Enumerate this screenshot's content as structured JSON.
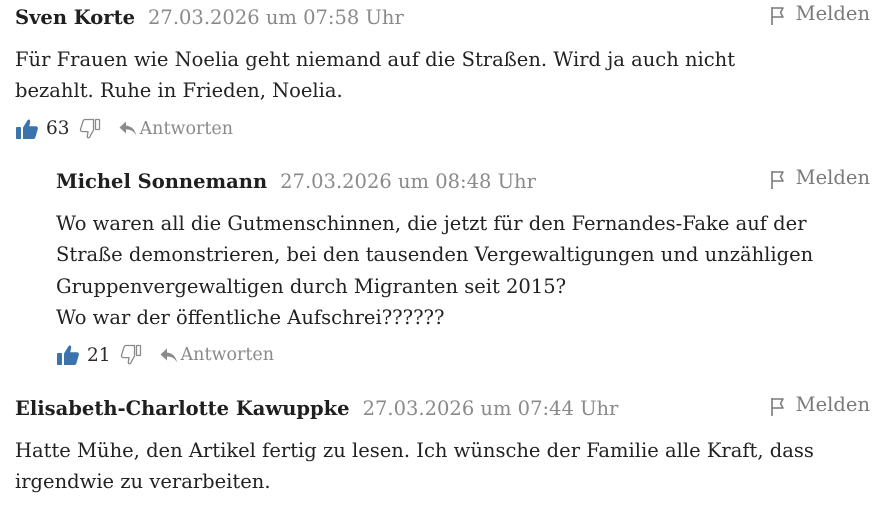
{
  "colors": {
    "accent": "#3b74ad",
    "muted": "#8a8a8a",
    "text": "#222222"
  },
  "icons": {
    "report": "flag-icon",
    "like": "thumbs-up-icon",
    "dislike": "thumbs-down-icon",
    "reply": "reply-arrow-icon"
  },
  "comments": [
    {
      "author": "Sven Korte",
      "date": "27.03.2026 um 07:58 Uhr",
      "report_label": "Melden",
      "lines": [
        "Für Frauen wie Noelia geht niemand auf die Straßen. Wird ja auch nicht",
        "bezahlt. Ruhe in Frieden, Noelia."
      ],
      "likes": "63",
      "reply_label": "Antworten"
    },
    {
      "author": "Michel Sonnemann",
      "date": "27.03.2026 um 08:48 Uhr",
      "report_label": "Melden",
      "lines": [
        "Wo waren all die Gutmenschinnen, die jetzt für den Fernandes-Fake auf der",
        "Straße demonstrieren, bei den tausenden Vergewaltigungen und unzähligen",
        "Gruppenvergewaltigen durch Migranten seit 2015?",
        "Wo war der öffentliche Aufschrei??????"
      ],
      "likes": "21",
      "reply_label": "Antworten"
    },
    {
      "author": "Elisabeth-Charlotte Kawuppke",
      "date": "27.03.2026 um 07:44 Uhr",
      "report_label": "Melden",
      "lines": [
        "Hatte Mühe, den Artikel fertig zu lesen. Ich wünsche der Familie alle Kraft, dass",
        "irgendwie zu verarbeiten."
      ]
    }
  ]
}
